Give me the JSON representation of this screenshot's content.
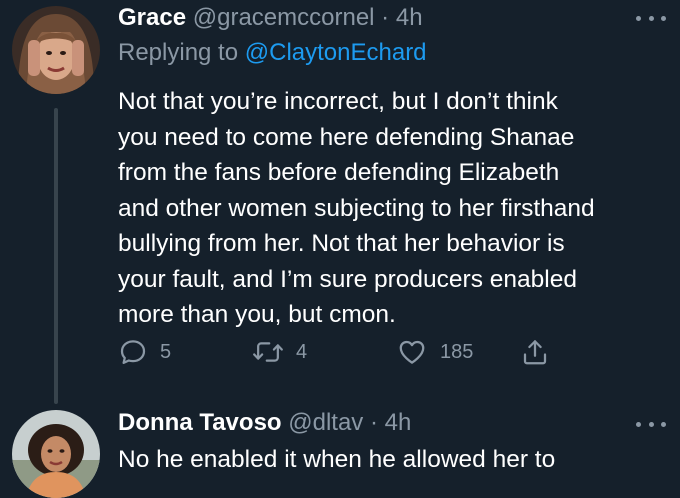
{
  "tweets": [
    {
      "author_name": "Grace",
      "handle": "@gracemccornel",
      "separator": "·",
      "time": "4h",
      "reply_prefix": "Replying to",
      "reply_mention": "@ClaytonEchard",
      "body_lines": [
        "Not that you’re incorrect, but I don’t think",
        "you need to come here defending Shanae",
        "from the fans before defending Elizabeth",
        "and other women subjecting to her firsthand",
        "bullying from her. Not that her behavior is",
        "your fault, and I’m sure producers enabled",
        "more than you, but cmon."
      ],
      "actions": {
        "reply_count": "5",
        "retweet_count": "4",
        "like_count": "185"
      }
    },
    {
      "author_name": "Donna Tavoso",
      "handle": "@dltav",
      "separator": "·",
      "time": "4h",
      "body_lines": [
        "No he enabled it when he allowed her to"
      ]
    }
  ],
  "colors": {
    "background": "#15202b",
    "text_primary": "#ffffff",
    "text_secondary": "#8b98a5",
    "accent_link": "#1d9bf0",
    "thread_line": "#38444d"
  },
  "icons": {
    "more": "more-horizontal-icon",
    "reply": "reply-icon",
    "retweet": "retweet-icon",
    "like": "heart-icon",
    "share": "share-icon"
  }
}
